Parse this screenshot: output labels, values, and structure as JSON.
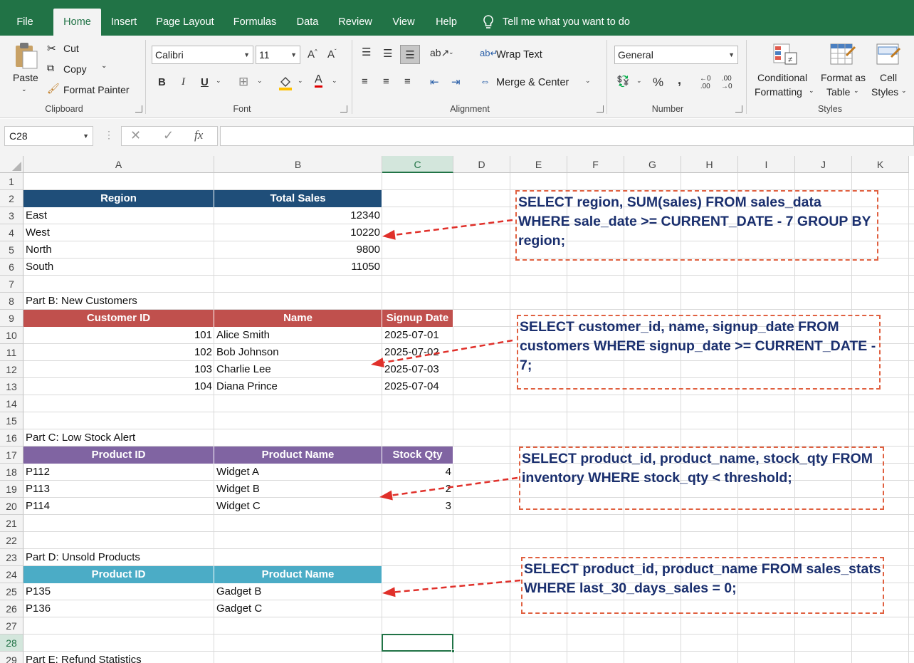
{
  "menu": {
    "tabs": [
      "File",
      "Home",
      "Insert",
      "Page Layout",
      "Formulas",
      "Data",
      "Review",
      "View",
      "Help"
    ],
    "active": "Home",
    "tell_me": "Tell me what you want to do"
  },
  "ribbon": {
    "clipboard": {
      "paste": "Paste",
      "cut": "Cut",
      "copy": "Copy",
      "format_painter": "Format Painter",
      "label": "Clipboard"
    },
    "font": {
      "name": "Calibri",
      "size": "11",
      "bold": "B",
      "italic": "I",
      "underline": "U",
      "label": "Font"
    },
    "alignment": {
      "wrap": "Wrap Text",
      "merge": "Merge & Center",
      "label": "Alignment"
    },
    "number": {
      "format": "General",
      "percent": "%",
      "comma": ",",
      "label": "Number"
    },
    "styles": {
      "conditional": "Conditional",
      "conditional2": "Formatting",
      "format_table": "Format as",
      "format_table2": "Table",
      "cell_styles": "Cell",
      "cell_styles2": "Styles",
      "label": "Styles"
    }
  },
  "formula_bar": {
    "name_box": "C28",
    "fx": "fx",
    "value": ""
  },
  "columns": [
    "A",
    "B",
    "C",
    "D",
    "E",
    "F",
    "G",
    "H",
    "I",
    "J",
    "K"
  ],
  "selected_column": "C",
  "selected_row": "28",
  "rows": [
    "1",
    "2",
    "3",
    "4",
    "5",
    "6",
    "7",
    "8",
    "9",
    "10",
    "11",
    "12",
    "13",
    "14",
    "15",
    "16",
    "17",
    "18",
    "19",
    "20",
    "21",
    "22",
    "23",
    "24",
    "25",
    "26",
    "27",
    "28",
    "29"
  ],
  "sections": {
    "region": {
      "headers": [
        "Region",
        "Total Sales"
      ],
      "rows": [
        [
          "East",
          "12340"
        ],
        [
          "West",
          "10220"
        ],
        [
          "North",
          "9800"
        ],
        [
          "South",
          "11050"
        ]
      ]
    },
    "customers": {
      "title": "Part B: New Customers",
      "headers": [
        "Customer ID",
        "Name",
        "Signup Date"
      ],
      "rows": [
        [
          "101",
          "Alice Smith",
          "2025-07-01"
        ],
        [
          "102",
          "Bob Johnson",
          "2025-07-02"
        ],
        [
          "103",
          "Charlie Lee",
          "2025-07-03"
        ],
        [
          "104",
          "Diana Prince",
          "2025-07-04"
        ]
      ]
    },
    "stock": {
      "title": "Part C: Low Stock Alert",
      "headers": [
        "Product ID",
        "Product Name",
        "Stock Qty"
      ],
      "rows": [
        [
          "P112",
          "Widget A",
          "4"
        ],
        [
          "P113",
          "Widget B",
          "2"
        ],
        [
          "P114",
          "Widget C",
          "3"
        ]
      ]
    },
    "unsold": {
      "title": "Part D: Unsold Products",
      "headers": [
        "Product ID",
        "Product Name"
      ],
      "rows": [
        [
          "P135",
          "Gadget B"
        ],
        [
          "P136",
          "Gadget C"
        ]
      ]
    },
    "refund": {
      "title": "Part E: Refund Statistics"
    }
  },
  "notes": [
    "SELECT region, SUM(sales) FROM sales_data WHERE sale_date >= CURRENT_DATE - 7 GROUP BY region;",
    "SELECT customer_id, name, signup_date FROM customers WHERE signup_date >= CURRENT_DATE - 7;",
    "SELECT product_id, product_name, stock_qty FROM inventory WHERE stock_qty < threshold;",
    "SELECT product_id, product_name FROM sales_stats WHERE last_30_days_sales = 0;"
  ],
  "colors": {
    "excel_green": "#217346",
    "region_hdr": "#1f4e79",
    "customer_hdr": "#c0504d",
    "stock_hdr": "#8064a2",
    "unsold_hdr": "#4bacc6",
    "note_text": "#1a2f6e",
    "note_border": "#e06040",
    "arrow": "#e0302a"
  }
}
